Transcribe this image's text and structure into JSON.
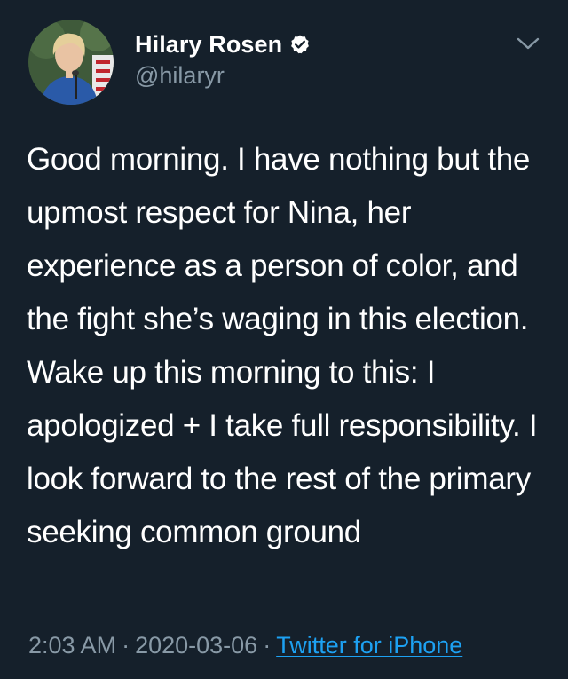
{
  "tweet": {
    "display_name": "Hilary Rosen",
    "handle": "@hilaryr",
    "verified": true,
    "body": "Good morning. I have nothing but the upmost respect for Nina, her experience as a person of color, and the fight she’s waging in this election. Wake up this morning to this: I apologized + I take full responsibility. I look forward to the rest of the primary seeking common ground",
    "time": "2:03 AM",
    "separator": "·",
    "date": "2020-03-06",
    "source": "Twitter for iPhone"
  },
  "icons": {
    "verified": "verified-badge-icon",
    "more": "chevron-down-icon"
  },
  "colors": {
    "background": "#15202b",
    "text": "#ffffff",
    "secondary_text": "#8899a6",
    "link": "#1da1f2"
  }
}
